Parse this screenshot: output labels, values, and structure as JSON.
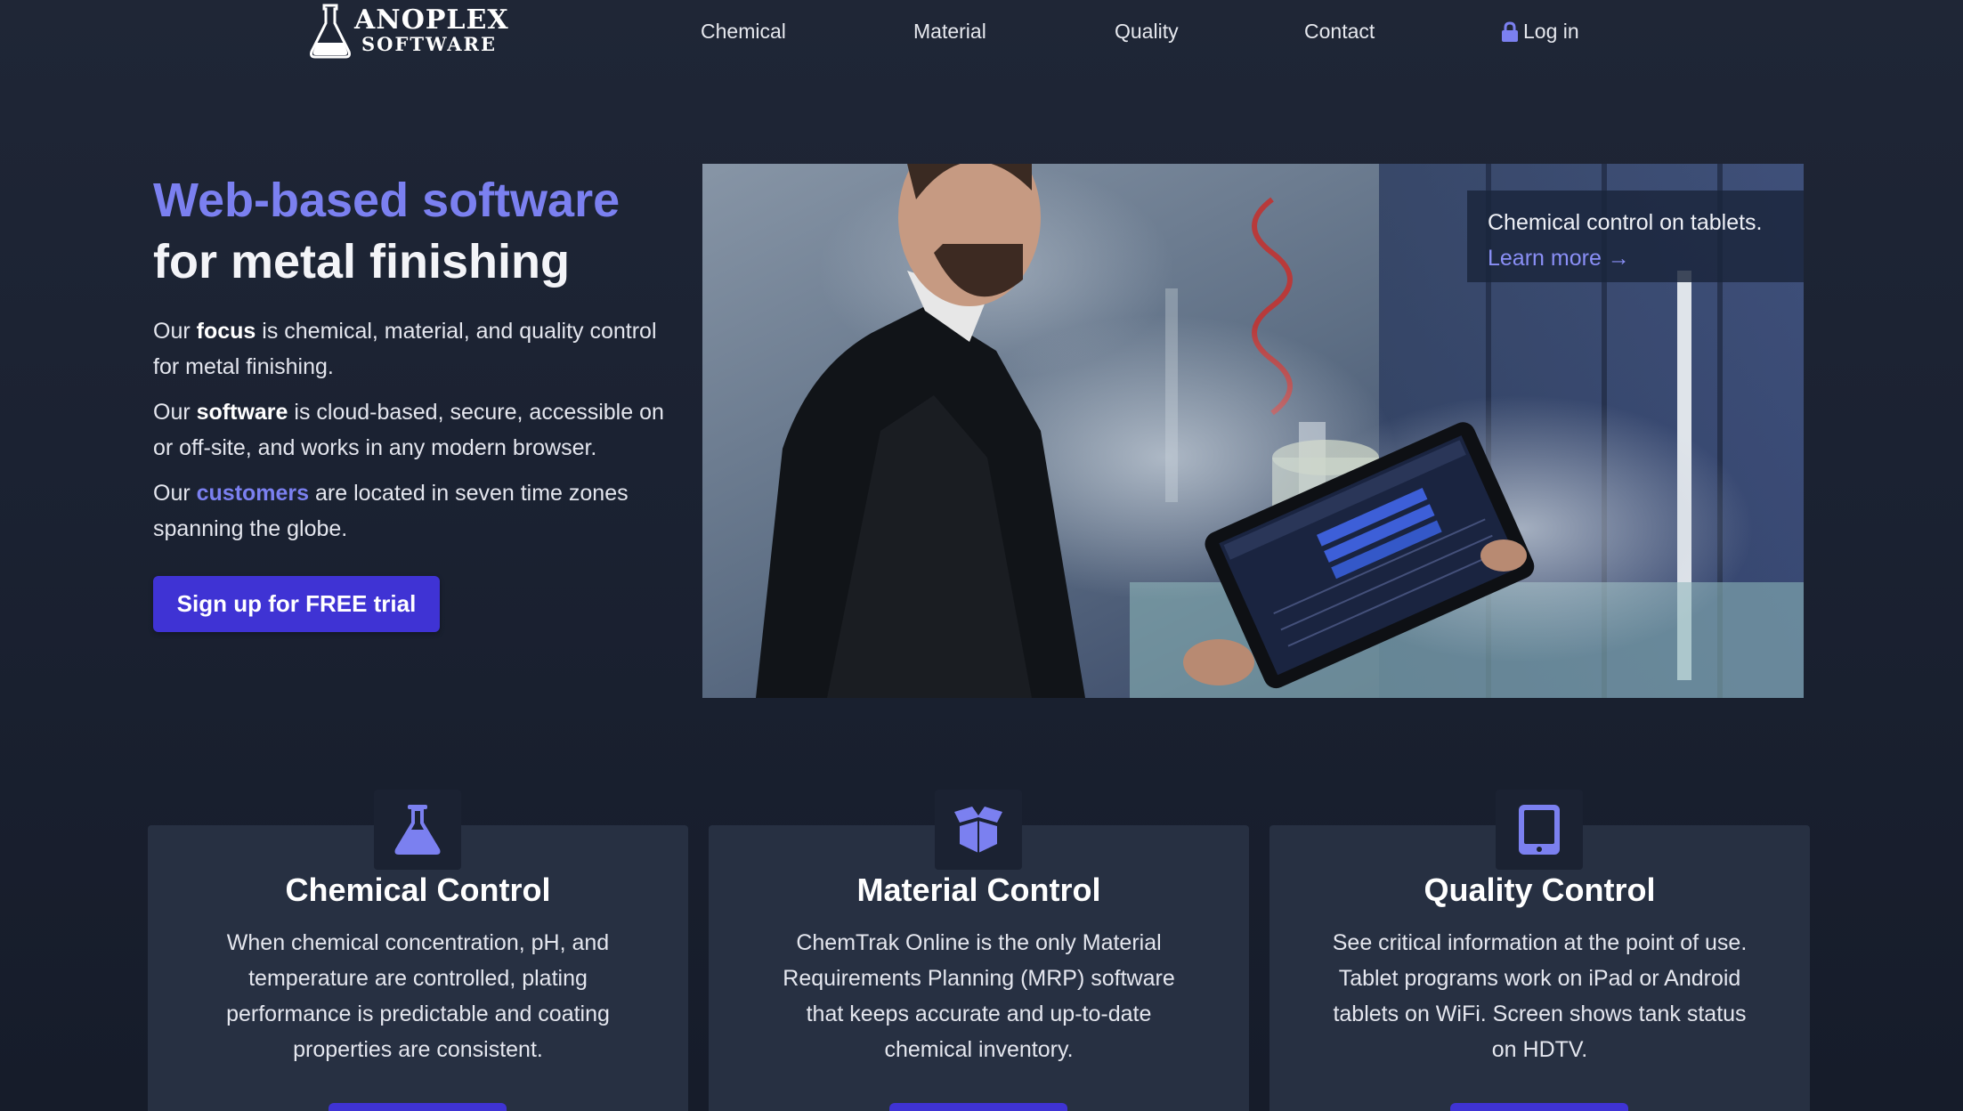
{
  "nav": {
    "logo_line1": "ANOPLEX",
    "logo_line2": "SOFTWARE",
    "links": [
      "Chemical",
      "Material",
      "Quality",
      "Contact"
    ],
    "login_label": "Log in"
  },
  "hero": {
    "title_accent": "Web-based software",
    "title_rest": "for metal finishing",
    "p1": {
      "pre": "Our ",
      "bold": "focus",
      "post": " is chemical, material, and quality control for metal finishing."
    },
    "p2": {
      "pre": "Our ",
      "bold": "software",
      "post": " is cloud-based, secure, accessible on or off-site, and works in any modern browser."
    },
    "p3": {
      "pre": "Our ",
      "link": "customers",
      "post": " are located in seven time zones spanning the globe."
    },
    "cta_label": "Sign up for FREE trial",
    "caption_text": "Chemical control on tablets.",
    "caption_link": "Learn more →"
  },
  "cards": [
    {
      "icon": "flask-icon",
      "title": "Chemical Control",
      "text": "When chemical concentration, pH, and temperature are controlled, plating performance is predictable and coating properties are consistent."
    },
    {
      "icon": "box-icon",
      "title": "Material Control",
      "text": "ChemTrak Online is the only Material Requirements Planning (MRP) software that keeps accurate and up-to-date chemical inventory."
    },
    {
      "icon": "tablet-icon",
      "title": "Quality Control",
      "text": "See critical information at the point of use. Tablet programs work on iPad or Android tablets on WiFi. Screen shows tank status on HDTV."
    }
  ],
  "colors": {
    "accent": "#7b80f0",
    "button": "#3f33d4",
    "background": "#1b2232",
    "card": "#273042"
  }
}
